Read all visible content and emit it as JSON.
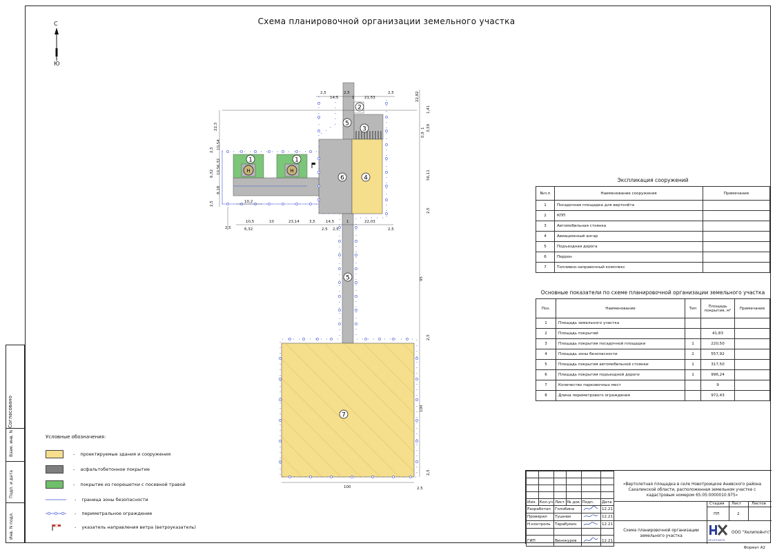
{
  "drawing": {
    "title": "Схема планировочной организации земельного участка",
    "compass": {
      "north": "С",
      "south": "Ю"
    },
    "markers": [
      "1",
      "1",
      "2",
      "3",
      "4",
      "5",
      "5",
      "6",
      "7"
    ],
    "helipad_letter": "H",
    "dimensions": [
      "2,5",
      "14,5",
      "2,5",
      "1",
      "21,53",
      "2,5",
      "22,82",
      "1,41",
      "22,3",
      "3,59",
      "0,9",
      "1",
      "10,54",
      "2,5",
      "6,32",
      "10,5",
      "6,32",
      "8,18",
      "10,2",
      "2,5",
      "56,11",
      "2,5",
      "2,5",
      "10,5",
      "10",
      "23,14",
      "3,5",
      "2,5",
      "2,5",
      "14,5",
      "1",
      "22,03",
      "2,5",
      "6,32",
      "95",
      "2,5",
      "100",
      "2,5",
      "100",
      "2,5"
    ]
  },
  "explication": {
    "title": "Экспликация сооружений",
    "headers": [
      "№п.п",
      "Наименование сооружения",
      "Примечание"
    ],
    "rows": [
      [
        "1",
        "Посадочная площадка для вертолёта",
        ""
      ],
      [
        "2",
        "КПП",
        ""
      ],
      [
        "3",
        "Автомобильная стоянка",
        ""
      ],
      [
        "4",
        "Авиационный ангар",
        ""
      ],
      [
        "5",
        "Подъездная дорога",
        ""
      ],
      [
        "6",
        "Перрон",
        ""
      ],
      [
        "7",
        "Топливно-заправочный комплекс",
        ""
      ]
    ]
  },
  "indicators": {
    "title": "Основные показатели по схеме планировочной организации земельного участка",
    "headers": [
      "Поз.",
      "Наименование",
      "Тип",
      "Площадь покрытия, м²",
      "Примечание"
    ],
    "rows": [
      [
        "1",
        "Площадь земельного участка",
        "",
        "",
        ""
      ],
      [
        "2",
        "Площадь покрытий",
        "",
        "41,83",
        ""
      ],
      [
        "3",
        "Площадь покрытия посадочной площадки",
        "1",
        "220,50",
        ""
      ],
      [
        "4",
        "Площадь зоны безопасности",
        "2",
        "557,92",
        ""
      ],
      [
        "5",
        "Площадь покрытия автомобильной стоянки",
        "1",
        "317,50",
        ""
      ],
      [
        "6",
        "Площадь покрытия подъездной дороги",
        "1",
        "996,24",
        ""
      ],
      [
        "7",
        "Количество парковочных мест",
        "",
        "9",
        ""
      ],
      [
        "8",
        "Длина периметрового ограждения",
        "",
        "972,43",
        ""
      ]
    ]
  },
  "legend": {
    "title": "Условные обозначения:",
    "items": [
      {
        "label": "проектируемые здания и сооружения",
        "color": "#f5de8c"
      },
      {
        "label": "асфальтобетонное покрытие",
        "color": "#7e7e7e"
      },
      {
        "label": "покрытие из георешетки с посевной травой",
        "color": "#6fbf6a"
      },
      {
        "label": "граница зоны безопасности",
        "color": "#3a4fd8"
      },
      {
        "label": "периметральное ограждение",
        "color": "#3a4fd8"
      },
      {
        "label": "указатель направления ветра (ветроуказатель)",
        "color": "#c0392b"
      }
    ]
  },
  "side_stamp": [
    "Согласовано",
    "Взам. инв. N",
    "Подп. и дата",
    "Инв. N подл."
  ],
  "stamp": {
    "project": "«Вертолетная площадка в селе Новотроицкое Анивского района Сахалинской области, расположенная земельном участке с кадастровым номером 65:05:0000010:975»",
    "col_headers": [
      "Изм.",
      "Кол.уч",
      "Лист",
      "№ док",
      "Подп.",
      "Дата"
    ],
    "roles": [
      {
        "role": "Разработал",
        "name": "Голобина",
        "date": "12.21"
      },
      {
        "role": "Проверил",
        "name": "Тушнюк",
        "date": "12.21"
      },
      {
        "role": "Н.контроль",
        "name": "Тарабукин",
        "date": "12.21"
      },
      {
        "role": "ГИП",
        "name": "Винокуров",
        "date": "12.21"
      }
    ],
    "stage_headers": [
      "Стадия",
      "Лист",
      "Листов"
    ],
    "stage": "ПП",
    "sheet": "2",
    "sheets": "",
    "sheet_title": "Схема планировочной организации земельного участка",
    "company": "ООО \"Хелипойнтс\"",
    "logo_text": "HELIPOINTS",
    "format": "Формат А2"
  },
  "colors": {
    "yellow": "#f5de8c",
    "asphalt": "#b8b8b8",
    "green": "#7cc67a",
    "fence": "#3a4fd8"
  }
}
